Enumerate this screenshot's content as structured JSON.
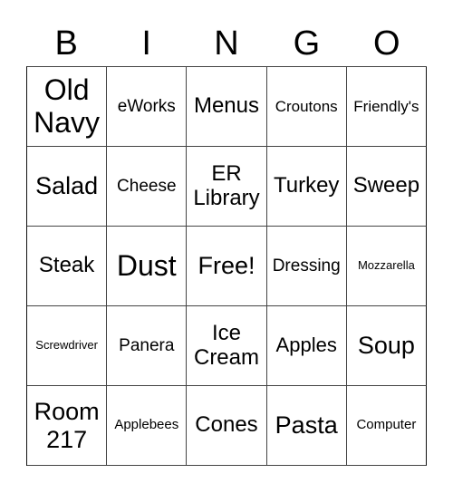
{
  "header": {
    "letters": [
      "B",
      "I",
      "N",
      "G",
      "O"
    ]
  },
  "card": {
    "rows": [
      [
        "Old Navy",
        "eWorks",
        "Menus",
        "Croutons",
        "Friendly's"
      ],
      [
        "Salad",
        "Cheese",
        "ER Library",
        "Turkey",
        "Sweep"
      ],
      [
        "Steak",
        "Dust",
        "Free!",
        "Dressing",
        "Mozzarella"
      ],
      [
        "Screwdriver",
        "Panera",
        "Ice Cream",
        "Apples",
        "Soup"
      ],
      [
        "Room 217",
        "Applebees",
        "Cones",
        "Pasta",
        "Computer"
      ]
    ]
  }
}
